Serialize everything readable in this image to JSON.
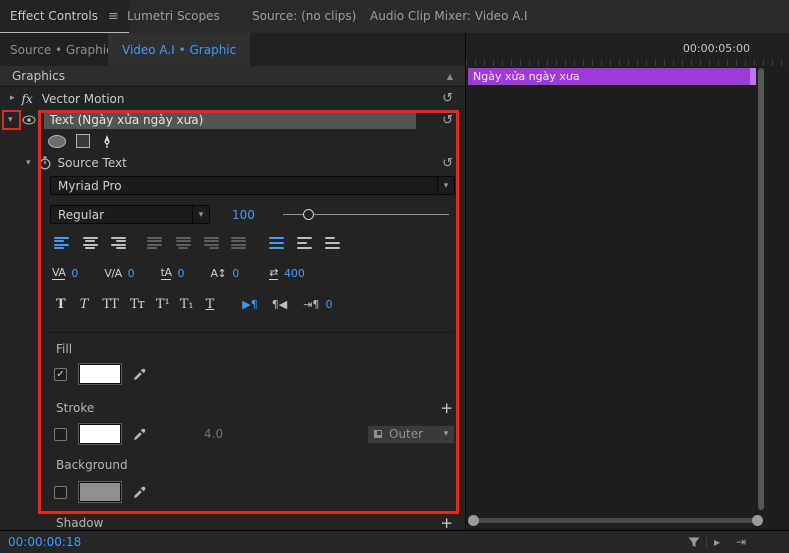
{
  "colors": {
    "accent_blue": "#3f9bfa",
    "annotation_red": "#df2a24",
    "clip_purple": "#9d3ad8"
  },
  "top_tabs": {
    "effect_controls": "Effect Controls",
    "menu_icon": "≡",
    "lumetri_scopes": "Lumetri Scopes",
    "source_monitor": "Source: (no clips)",
    "audio_clip_mixer": "Audio Clip Mixer: Video A.I"
  },
  "clip_tabs": {
    "source_graphic": "Source • Graphic",
    "video_graphic": "Video A.I • Graphic"
  },
  "ruler": {
    "timecode": "00:00:05:00"
  },
  "timeline": {
    "clip_label": "Ngày xửa ngày xưa"
  },
  "effects": {
    "header": "Graphics",
    "scroll_up_icon": "▲",
    "vector_motion": {
      "chevron": "▸",
      "badge": "fx",
      "label": "Vector Motion",
      "reset_icon": "↺"
    },
    "text_layer": {
      "chevron": "▾",
      "label": "Text (Ngày xửa ngày xưa)",
      "reset_icon": "↺"
    },
    "source_text": {
      "chevron": "▾",
      "label": "Source Text",
      "reset_icon": "↺"
    }
  },
  "type_controls": {
    "font_family": "Myriad Pro",
    "font_style": "Regular",
    "font_size": "100",
    "dropdown_chevron": "▾",
    "spacing": [
      {
        "icon": "VA",
        "value": "0"
      },
      {
        "icon": "V/A",
        "value": "0"
      },
      {
        "icon": "tA",
        "value": "0"
      },
      {
        "icon": "A↕",
        "value": "0"
      },
      {
        "icon": "⇄",
        "value": "400"
      }
    ],
    "style_buttons": [
      {
        "glyph": "T"
      },
      {
        "glyph": "T"
      },
      {
        "glyph": "TT"
      },
      {
        "glyph": "Tᴛ"
      },
      {
        "glyph": "T¹"
      },
      {
        "glyph": "T₁"
      },
      {
        "glyph": "T"
      }
    ],
    "paragraph_buttons": [
      {
        "glyph": "▶¶"
      },
      {
        "glyph": "¶◀"
      },
      {
        "glyph": "⇥¶"
      }
    ],
    "paragraph_value": "0"
  },
  "appearance": {
    "fill": {
      "label": "Fill",
      "checked": "✓"
    },
    "stroke": {
      "label": "Stroke",
      "width": "4.0",
      "type": "Outer",
      "add_icon": "+"
    },
    "background": {
      "label": "Background"
    },
    "shadow": {
      "label": "Shadow",
      "add_icon": "+"
    }
  },
  "status_bar": {
    "timecode": "00:00:00:18"
  }
}
